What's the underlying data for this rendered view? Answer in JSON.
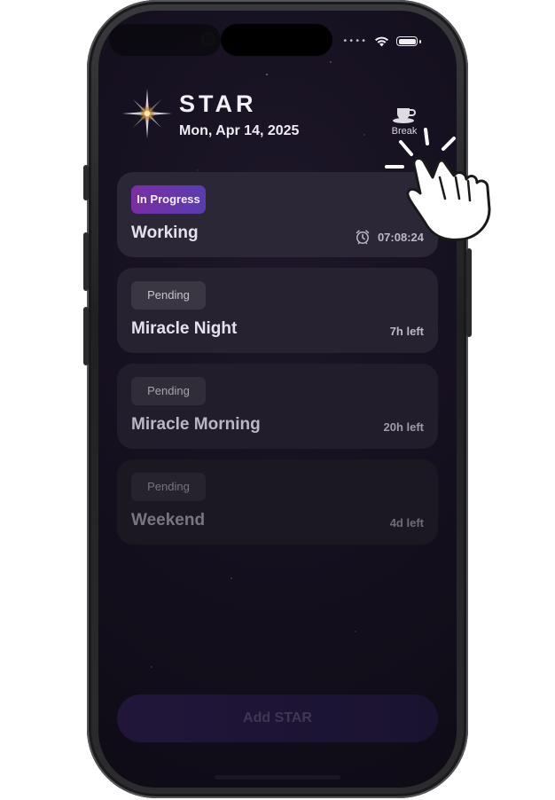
{
  "app": {
    "brand": "STAR",
    "date": "Mon, Apr 14, 2025"
  },
  "status_bar": {
    "signal": "••••"
  },
  "header": {
    "break_label": "Break"
  },
  "tasks": [
    {
      "status": "In Progress",
      "title": "Working",
      "right": "07:08:24",
      "icon": "alarm-clock-icon"
    },
    {
      "status": "Pending",
      "title": "Miracle Night",
      "right": "7h left"
    },
    {
      "status": "Pending",
      "title": "Miracle Morning",
      "right": "20h left"
    },
    {
      "status": "Pending",
      "title": "Weekend",
      "right": "4d left"
    }
  ],
  "footer": {
    "add_button": "Add STAR"
  },
  "colors": {
    "accent": "#7a2ea3",
    "background": "#140f1d",
    "card": "#2b2737"
  },
  "icons": [
    "star-logo-icon",
    "coffee-cup-icon",
    "wifi-icon",
    "battery-icon",
    "alarm-clock-icon",
    "tap-hand-icon"
  ]
}
